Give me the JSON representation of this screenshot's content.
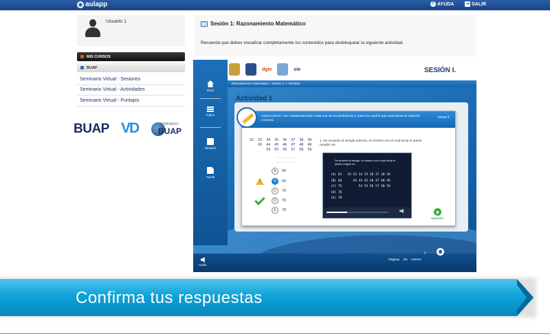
{
  "topbar": {
    "logo": "aulapp",
    "help": "AYUDA",
    "logout": "SALIR"
  },
  "user": {
    "name": "Usuario 1"
  },
  "sidebar": {
    "section": "MIS CURSOS",
    "course": "BUAP",
    "links": [
      "Seminario Virtual - Sesiones",
      "Seminario Virtual - Actividades",
      "Seminario Virtual - Puntajes"
    ]
  },
  "brands": {
    "buap": "BUAP",
    "vd": "VD",
    "seminario_small": "SEMINARIO",
    "seminario_big": "BUAP"
  },
  "main": {
    "title": "Sesión 1: Razonamiento Matemático",
    "note": "Recuerda que debes visualizar completamente los contenidos para desbloquear la siguiente actividad."
  },
  "player": {
    "session_label": "SESIÓN I.",
    "breadcrumb": "Razonamiento matemático > Sesión 1 > Actividad",
    "logo_texts": [
      "dgie",
      "cie"
    ],
    "nav": [
      "Inicio",
      "Índice",
      "Glosario",
      "Ayuda"
    ],
    "activity_title": "Actividad 1",
    "instructions": "Instrucciones: Lee cuidadosamente cada uno de los problemas y marca la opción que represente la solución correcta.",
    "close": "cerrar X",
    "sequence_rows": [
      "32  33  34  35  36  37  38  39",
      "    43  44  45  46  47  48  49",
      "        54  55  56  57  58  59"
    ],
    "question": "1. De acuerdo al arreglo anterior, el número con el cual inicia el quinto renglón es:",
    "options": [
      {
        "letter": "A",
        "value": "65"
      },
      {
        "letter": "B",
        "value": "66"
      },
      {
        "letter": "C",
        "value": "75"
      },
      {
        "letter": "D",
        "value": "76"
      },
      {
        "letter": "E",
        "value": "78"
      }
    ],
    "video": {
      "caption": "De acuerdo al arreglo, el número con el que inicia el quinto renglón es:",
      "rows": [
        "(A) 65   32 33 34 35 36 37 38 39",
        "(B) 66      43 44 45 46 47 48 49",
        "(C) 75         54 55 56 57 58 59",
        "(D) 76",
        "(E) 78"
      ]
    },
    "next": "siguiente",
    "audio": "Audio",
    "pages_label": "Páginas",
    "pages_value": "3/3",
    "prev": "Anterior"
  },
  "banner": {
    "text": "Confirma tus respuestas"
  },
  "colors": {
    "topbar": "#1d4a8c",
    "accent": "#0fa3d8",
    "player": "#1a6db4"
  }
}
